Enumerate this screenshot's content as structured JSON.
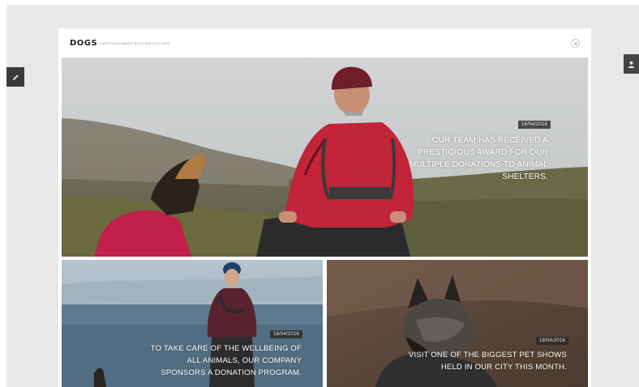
{
  "site": {
    "logo": "DOGS",
    "tagline": "Everything about dogs and dog care"
  },
  "side_tabs": {
    "left_icon": "pencil-icon",
    "right_icon": "user-icon"
  },
  "posts": [
    {
      "date": "18/04/2016",
      "title": "Our team has received a prestigious award for our multiple donations to animal shelters."
    },
    {
      "date": "18/04/2016",
      "title": "To take care of the wellbeing of all animals, our company sponsors a donation program."
    },
    {
      "date": "18/04/2016",
      "title": "Visit one of the biggest pet shows held in our city this month."
    }
  ],
  "colors": {
    "background": "#e8e8e8",
    "page": "#ffffff",
    "badge": "#2a2a2a",
    "text": "#ffffff"
  }
}
